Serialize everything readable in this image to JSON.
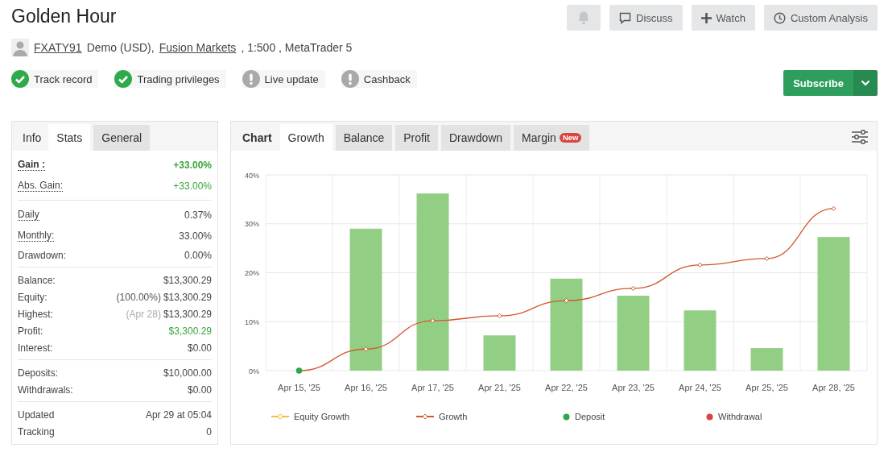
{
  "title": "Golden Hour",
  "account": {
    "user": "FXATY91",
    "type": "Demo (USD),",
    "broker": "Fusion Markets",
    "details": ", 1:500 , MetaTrader 5"
  },
  "checks": [
    {
      "label": "Track record",
      "ok": true
    },
    {
      "label": "Trading privileges",
      "ok": true
    },
    {
      "label": "Live update",
      "ok": false
    },
    {
      "label": "Cashback",
      "ok": false
    }
  ],
  "actions": [
    {
      "kind": "bell"
    },
    {
      "kind": "comment",
      "label": "Discuss"
    },
    {
      "kind": "plus",
      "label": "Watch"
    },
    {
      "kind": "clock",
      "label": "Custom Analysis"
    }
  ],
  "subscribe": {
    "label": "Subscribe"
  },
  "stats_panel": {
    "label": "Info",
    "tabs": [
      {
        "label": "Stats",
        "selected": true
      },
      {
        "label": "General",
        "selected": false
      }
    ],
    "groups": [
      [
        {
          "label": "Gain :",
          "value": "+33.00%",
          "bold": true,
          "dotted": true,
          "positive": true
        },
        {
          "label": "Abs. Gain:",
          "value": "+33.00%",
          "bold": false,
          "dotted": true,
          "positive": true
        }
      ],
      [
        {
          "label": "Daily",
          "value": "0.37%",
          "bold": false,
          "dotted": true,
          "positive": false
        },
        {
          "label": "Monthly:",
          "value": "33.00%",
          "bold": false,
          "dotted": true,
          "positive": false
        },
        {
          "label": "Drawdown:",
          "value": "0.00%",
          "bold": false,
          "dotted": false,
          "positive": false
        }
      ],
      [
        {
          "label": "Balance:",
          "value": "$13,300.29",
          "bold": false,
          "dotted": false,
          "positive": false
        },
        {
          "label": "Equity:",
          "note": "(100.00%)",
          "value": "$13,300.29",
          "bold": false,
          "dotted": false,
          "positive": false
        },
        {
          "label": "Highest:",
          "note": "(Apr 28)",
          "value": "$13,300.29",
          "bold": false,
          "dotted": false,
          "positive": false
        },
        {
          "label": "Profit:",
          "value": "$3,300.29",
          "bold": false,
          "dotted": false,
          "positive": true
        },
        {
          "label": "Interest:",
          "value": "$0.00",
          "bold": false,
          "dotted": false,
          "positive": false
        }
      ],
      [
        {
          "label": "Deposits:",
          "value": "$10,000.00",
          "bold": false,
          "dotted": false,
          "positive": false
        },
        {
          "label": "Withdrawals:",
          "value": "$0.00",
          "bold": false,
          "dotted": false,
          "positive": false
        }
      ],
      [
        {
          "label": "Updated",
          "value": "Apr 29 at 05:04",
          "bold": false,
          "dotted": false,
          "positive": false
        },
        {
          "label": "Tracking",
          "value": "0",
          "bold": false,
          "dotted": false,
          "positive": false
        }
      ]
    ]
  },
  "chart_panel": {
    "label": "Chart",
    "tabs": [
      {
        "label": "Growth",
        "selected": true
      },
      {
        "label": "Balance",
        "selected": false
      },
      {
        "label": "Profit",
        "selected": false
      },
      {
        "label": "Drawdown",
        "selected": false
      },
      {
        "label": "Margin",
        "selected": false,
        "badge": "New"
      }
    ],
    "chart_data": {
      "type": "bar",
      "grid": true,
      "categories": [
        "Apr 15, '25",
        "Apr 16, '25",
        "Apr 17, '25",
        "Apr 21, '25",
        "Apr 22, '25",
        "Apr 23, '25",
        "Apr 24, '25",
        "Apr 25, '25",
        "Apr 28, '25"
      ],
      "ylim": [
        0,
        40
      ],
      "yticks": [
        {
          "value": 0,
          "label": "0%"
        },
        {
          "value": 10,
          "label": "10%"
        },
        {
          "value": 20,
          "label": "20%"
        },
        {
          "value": 30,
          "label": "30%"
        },
        {
          "value": 40,
          "label": "40%"
        }
      ],
      "series": [
        {
          "color": "#92cf84",
          "values": [
            null,
            29.0,
            36.2,
            7.2,
            18.8,
            15.3,
            12.3,
            4.6,
            27.3
          ]
        },
        {
          "name": "Equity Growth",
          "type": "line",
          "marker": "circle",
          "color": "#e8c440",
          "values": [
            null,
            null,
            null,
            null,
            null,
            null,
            null,
            null,
            null
          ]
        },
        {
          "name": "Growth",
          "type": "line",
          "marker": "diamond",
          "color": "#d2572b",
          "values": [
            0,
            4.4,
            10.2,
            11.2,
            14.3,
            16.8,
            21.6,
            22.9,
            33.1
          ]
        },
        {
          "name": "Deposit",
          "type": "scatter",
          "color": "#2fa84a",
          "values": [
            0,
            null,
            null,
            null,
            null,
            null,
            null,
            null,
            null
          ]
        },
        {
          "name": "Withdrawal",
          "type": "scatter",
          "color": "#d9443f",
          "values": [
            null,
            null,
            null,
            null,
            null,
            null,
            null,
            null,
            null
          ]
        }
      ]
    }
  }
}
